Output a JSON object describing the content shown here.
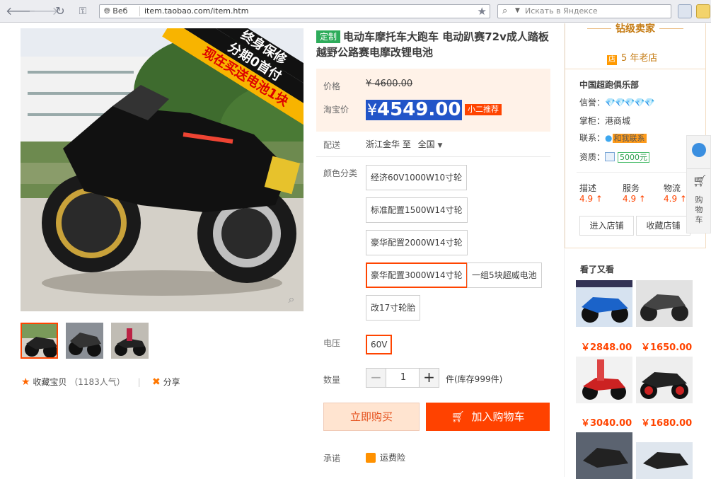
{
  "browser": {
    "protocol_label": "Веб",
    "url": "item.taobao.com/item.htm",
    "search_placeholder": "Искать в Яндексе"
  },
  "gallery": {
    "banner_line1": "终身保修",
    "banner_line2": "分期0首付",
    "banner_line3": "现在买送电池1块",
    "favorite_label": "收藏宝贝",
    "favorite_count": "（1183人气）",
    "share_label": "分享"
  },
  "product": {
    "custom_badge": "定制",
    "title": "电动车摩托车大跑车 电动趴赛72v成人踏板越野公路赛电摩改锂电池",
    "price_label": "价格",
    "original_price": "¥ 4600.00",
    "taobao_price_label": "淘宝价",
    "currency": "¥",
    "taobao_price": "4549.00",
    "recommend_badge": "小二推荐",
    "shipping_label": "配送",
    "shipping_from": "浙江金华 至",
    "shipping_to": "全国",
    "color_label": "颜色分类",
    "options": [
      "经济60V1000W10寸轮",
      "标准配置1500W14寸轮",
      "豪华配置2000W14寸轮",
      "豪华配置3000W14寸轮",
      "一组5块超威电池",
      "改17寸轮胎"
    ],
    "voltage_label": "电压",
    "voltage_value": "60V",
    "quantity_label": "数量",
    "quantity_minus": "−",
    "quantity_value": "1",
    "quantity_plus": "+",
    "stock_text": "件(库存999件)",
    "buy_now": "立即购买",
    "add_to_cart": "加入购物车",
    "promise_label": "承诺",
    "promise_value": "运费险"
  },
  "shop": {
    "level": "钻级卖家",
    "age": "5 年老店",
    "age_icon": "店",
    "name": "中国超跑俱乐部",
    "rating_label": "信誉：",
    "rating_diamonds": "💎💎💎💎💎",
    "owner_label": "掌柜：",
    "owner": "港商城",
    "contact_label": "联系：",
    "contact_value": "和我联系",
    "qual_label": "资质：",
    "deposit": "5000元",
    "score_labels": [
      "描述",
      "服务",
      "物流"
    ],
    "scores": [
      "4.9 ↑",
      "4.9 ↑",
      "4.9 ↑"
    ],
    "enter_shop": "进入店铺",
    "collect_shop": "收藏店铺"
  },
  "recommend": {
    "title": "看了又看",
    "prices": [
      "￥2848.00",
      "￥1650.00",
      "￥3040.00",
      "￥1680.00"
    ]
  },
  "sidetab": {
    "cart_label": "购物车"
  },
  "colors": {
    "accent": "#ff4400",
    "price_highlight": "#2255c8",
    "custom_badge": "#2eac5b"
  }
}
